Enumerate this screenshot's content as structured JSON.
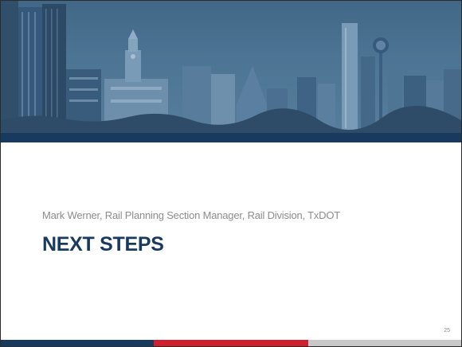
{
  "slide": {
    "subtitle": "Mark Werner, Rail Planning Section Manager, Rail Division, TxDOT",
    "title": "NEXT STEPS",
    "page_number": "25"
  },
  "banner": {
    "image": "dallas-fort-worth-skyline-photo",
    "tint": "#4a7090"
  },
  "colors": {
    "navy": "#173a5e",
    "red": "#d0202e",
    "gray": "#c8c8c8",
    "subtitle_text": "#8c8c8c"
  }
}
